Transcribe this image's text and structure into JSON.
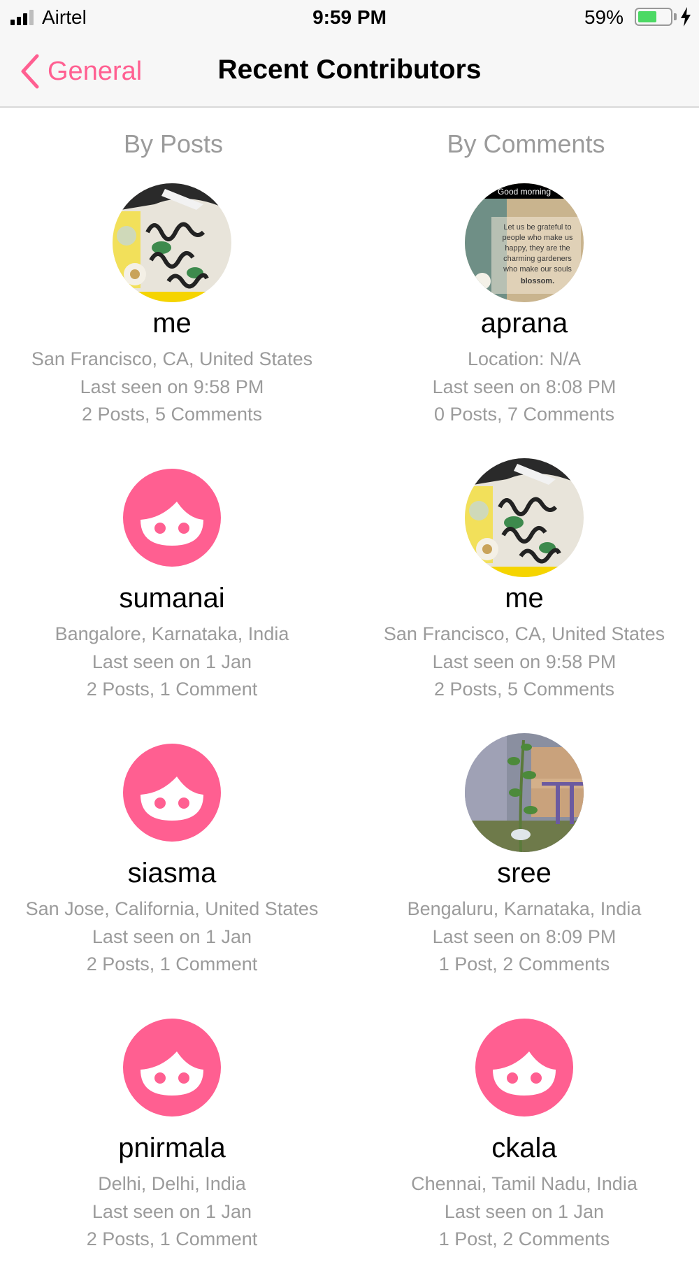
{
  "status_bar": {
    "carrier": "Airtel",
    "time": "9:59 PM",
    "battery_percent": "59%",
    "battery_level": 0.59,
    "signal_bars": 3
  },
  "nav": {
    "back_label": "General",
    "title": "Recent Contributors"
  },
  "accent_color": "#ff5f91",
  "columns": {
    "posts_header": "By Posts",
    "comments_header": "By Comments"
  },
  "by_posts": [
    {
      "name": "me",
      "location": "San Francisco, CA, United States",
      "last_seen": "Last seen on 9:58 PM",
      "counts": "2 Posts, 5 Comments",
      "avatar": "cake-photo"
    },
    {
      "name": "sumanai",
      "location": "Bangalore, Karnataka, India",
      "last_seen": "Last seen on 1 Jan",
      "counts": "2 Posts, 1 Comment",
      "avatar": "default-face-icon"
    },
    {
      "name": "siasma",
      "location": "San Jose, California, United States",
      "last_seen": "Last seen on 1 Jan",
      "counts": "2 Posts, 1 Comment",
      "avatar": "default-face-icon"
    },
    {
      "name": "pnirmala",
      "location": "Delhi, Delhi, India",
      "last_seen": "Last seen on 1 Jan",
      "counts": "2 Posts, 1 Comment",
      "avatar": "default-face-icon"
    }
  ],
  "by_comments": [
    {
      "name": "aprana",
      "location": "Location: N/A",
      "last_seen": "Last seen on 8:08 PM",
      "counts": "0 Posts, 7 Comments",
      "avatar": "quote-photo",
      "avatar_text": {
        "banner": "Good morning",
        "line1": "Let us be grateful to",
        "line2": "people who make us",
        "line3": "happy, they are the",
        "line4": "charming gardeners",
        "line5": "who make our souls",
        "line6": "blossom."
      }
    },
    {
      "name": "me",
      "location": "San Francisco, CA, United States",
      "last_seen": "Last seen on 9:58 PM",
      "counts": "2 Posts, 5 Comments",
      "avatar": "cake-photo"
    },
    {
      "name": "sree",
      "location": "Bengaluru, Karnataka, India",
      "last_seen": "Last seen on 8:09 PM",
      "counts": "1 Post, 2 Comments",
      "avatar": "plant-photo"
    },
    {
      "name": "ckala",
      "location": "Chennai, Tamil Nadu, India",
      "last_seen": "Last seen on 1 Jan",
      "counts": "1 Post, 2 Comments",
      "avatar": "default-face-icon"
    }
  ]
}
